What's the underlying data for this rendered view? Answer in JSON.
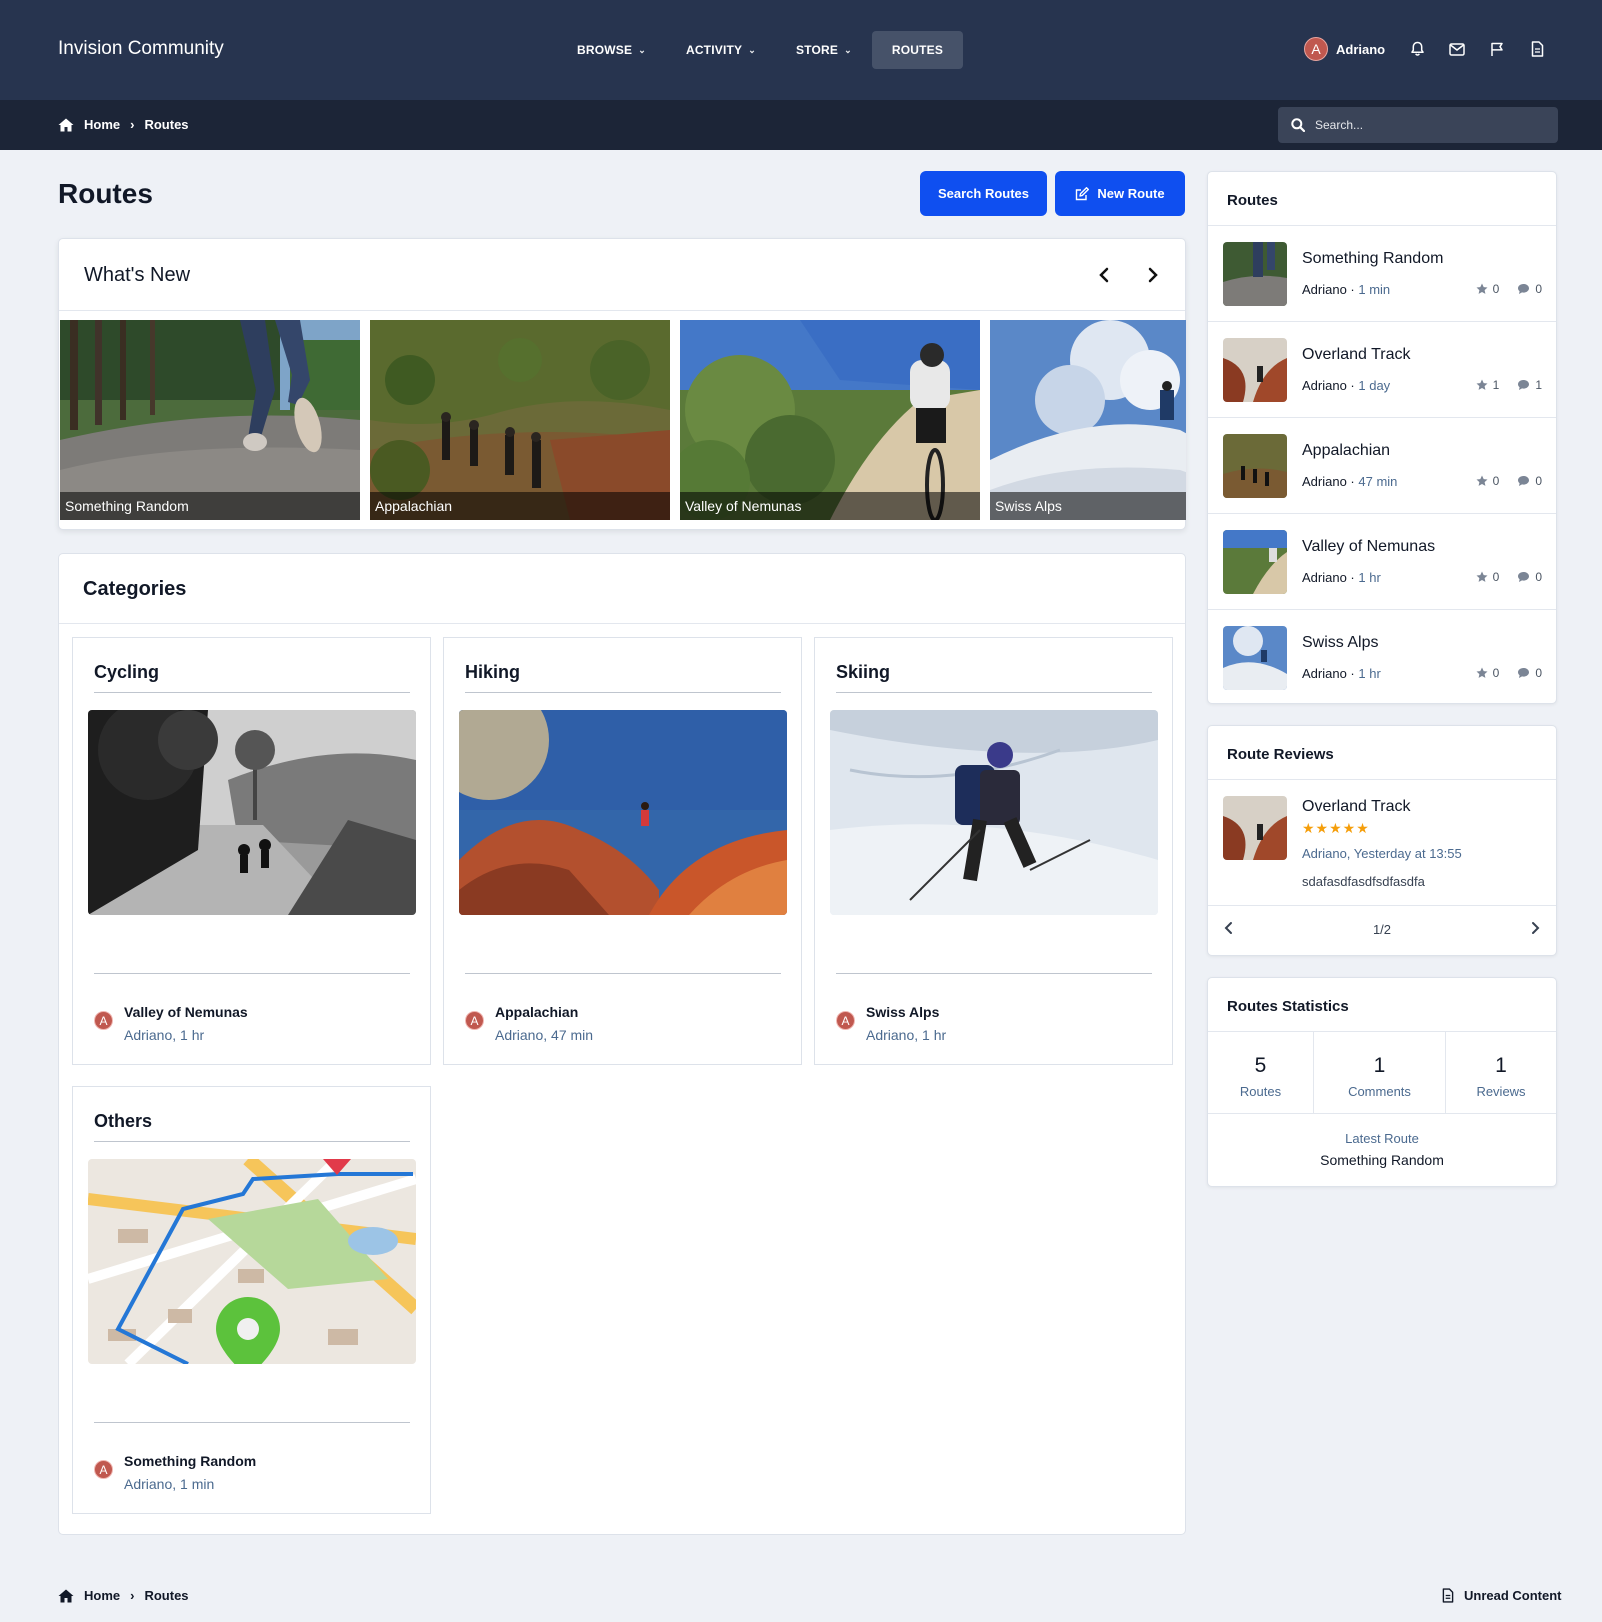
{
  "header": {
    "brand": "Invision Community",
    "nav": [
      {
        "label": "BROWSE",
        "dropdown": true
      },
      {
        "label": "ACTIVITY",
        "dropdown": true
      },
      {
        "label": "STORE",
        "dropdown": true
      },
      {
        "label": "ROUTES",
        "dropdown": false,
        "active": true
      }
    ],
    "user": {
      "initial": "A",
      "name": "Adriano"
    },
    "icons": [
      "bell-icon",
      "envelope-icon",
      "flag-icon",
      "document-icon"
    ]
  },
  "breadcrumb": {
    "home": "Home",
    "current": "Routes"
  },
  "search": {
    "placeholder": "Search..."
  },
  "page": {
    "title": "Routes",
    "search_routes_label": "Search Routes",
    "new_route_label": "New Route"
  },
  "whats_new": {
    "title": "What's New",
    "slides": [
      "Something Random",
      "Appalachian",
      "Valley of Nemunas",
      "Swiss Alps"
    ]
  },
  "categories": {
    "title": "Categories",
    "items": [
      {
        "name": "Cycling",
        "latest_title": "Valley of Nemunas",
        "latest_meta": "Adriano, 1 hr",
        "avatar": "A"
      },
      {
        "name": "Hiking",
        "latest_title": "Appalachian",
        "latest_meta": "Adriano, 47 min",
        "avatar": "A"
      },
      {
        "name": "Skiing",
        "latest_title": "Swiss Alps",
        "latest_meta": "Adriano, 1 hr",
        "avatar": "A"
      },
      {
        "name": "Others",
        "latest_title": "Something Random",
        "latest_meta": "Adriano, 1 min",
        "avatar": "A"
      }
    ]
  },
  "sidebar_routes": {
    "title": "Routes",
    "items": [
      {
        "title": "Something Random",
        "author": "Adriano",
        "ago": "1 min",
        "rating": "0",
        "comments": "0"
      },
      {
        "title": "Overland Track",
        "author": "Adriano",
        "ago": "1 day",
        "rating": "1",
        "comments": "1"
      },
      {
        "title": "Appalachian",
        "author": "Adriano",
        "ago": "47 min",
        "rating": "0",
        "comments": "0"
      },
      {
        "title": "Valley of Nemunas",
        "author": "Adriano",
        "ago": "1 hr",
        "rating": "0",
        "comments": "0"
      },
      {
        "title": "Swiss Alps",
        "author": "Adriano",
        "ago": "1 hr",
        "rating": "0",
        "comments": "0"
      }
    ]
  },
  "route_reviews": {
    "title": "Route Reviews",
    "review": {
      "route": "Overland Track",
      "stars": "★★★★★",
      "rating_value": 5,
      "meta": "Adriano, Yesterday at 13:55",
      "text": "sdafasdfasdfsdfasdfa"
    },
    "pager": "1/2"
  },
  "statistics": {
    "title": "Routes Statistics",
    "cells": [
      {
        "value": "5",
        "label": "Routes"
      },
      {
        "value": "1",
        "label": "Comments"
      },
      {
        "value": "1",
        "label": "Reviews"
      }
    ],
    "latest_label": "Latest Route",
    "latest_value": "Something Random"
  },
  "footer": {
    "home": "Home",
    "current": "Routes",
    "unread": "Unread Content"
  },
  "colors": {
    "header": "#27344f",
    "subbar": "#1c2537",
    "primary_button": "#0f4ff0",
    "avatar": "#c0584f",
    "star": "#f59e0b"
  }
}
